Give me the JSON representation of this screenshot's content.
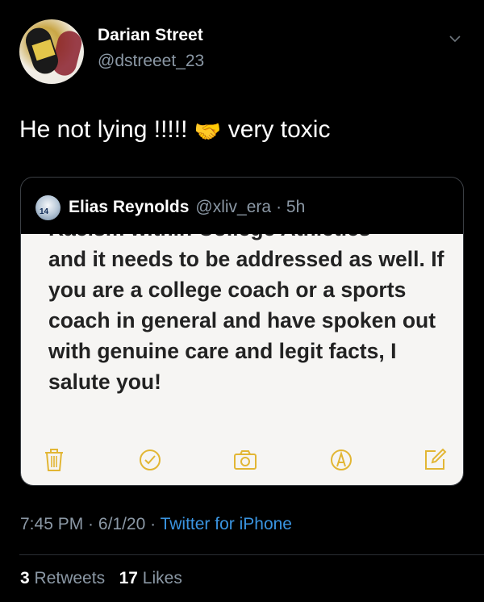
{
  "tweet": {
    "display_name": "Darian Street",
    "handle": "@dstreeet_23",
    "text": "He not lying !!!!!",
    "emoji": "🤝",
    "text_after": "very toxic"
  },
  "quote": {
    "display_name": "Elias Reynolds",
    "handle": "@xliv_era",
    "time": "· 5h",
    "avatar_number": "14",
    "note_cut_line": "Racism within College Athletics",
    "note_text": "and it needs to be addressed as well. If you are a college coach or a sports coach in general and have spoken out with genuine care and legit facts, I salute you!"
  },
  "meta": {
    "time": "7:45 PM",
    "sep1": " · ",
    "date": "6/1/20",
    "sep2": " · ",
    "source": "Twitter for iPhone"
  },
  "stats": {
    "retweets_count": "3",
    "retweets_label": "Retweets",
    "likes_count": "17",
    "likes_label": "Likes"
  },
  "colors": {
    "accent_link": "#3a94e0",
    "notes_yellow": "#e2b634"
  }
}
